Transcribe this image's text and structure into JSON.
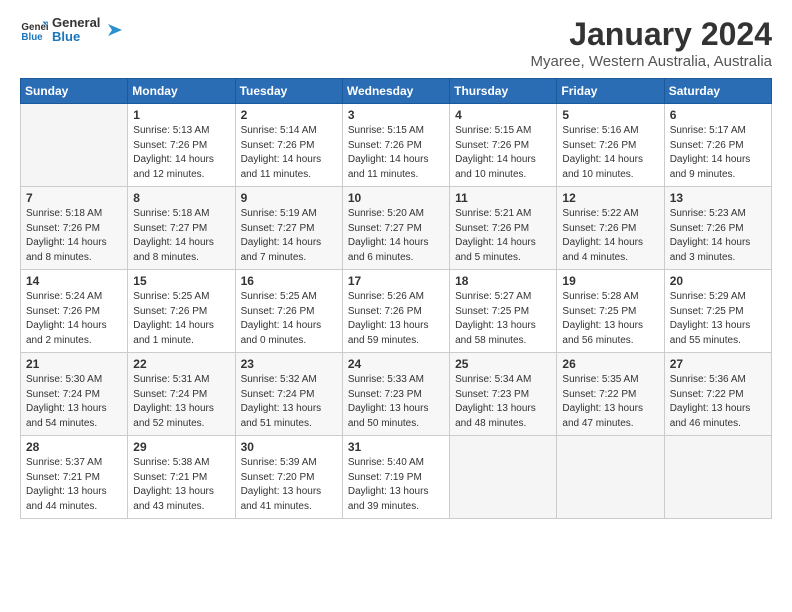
{
  "logo": {
    "text_general": "General",
    "text_blue": "Blue"
  },
  "title": "January 2024",
  "location": "Myaree, Western Australia, Australia",
  "weekdays": [
    "Sunday",
    "Monday",
    "Tuesday",
    "Wednesday",
    "Thursday",
    "Friday",
    "Saturday"
  ],
  "weeks": [
    [
      {
        "day": "",
        "empty": true
      },
      {
        "day": "1",
        "sunrise": "5:13 AM",
        "sunset": "7:26 PM",
        "daylight": "14 hours and 12 minutes."
      },
      {
        "day": "2",
        "sunrise": "5:14 AM",
        "sunset": "7:26 PM",
        "daylight": "14 hours and 11 minutes."
      },
      {
        "day": "3",
        "sunrise": "5:15 AM",
        "sunset": "7:26 PM",
        "daylight": "14 hours and 11 minutes."
      },
      {
        "day": "4",
        "sunrise": "5:15 AM",
        "sunset": "7:26 PM",
        "daylight": "14 hours and 10 minutes."
      },
      {
        "day": "5",
        "sunrise": "5:16 AM",
        "sunset": "7:26 PM",
        "daylight": "14 hours and 10 minutes."
      },
      {
        "day": "6",
        "sunrise": "5:17 AM",
        "sunset": "7:26 PM",
        "daylight": "14 hours and 9 minutes."
      }
    ],
    [
      {
        "day": "7",
        "sunrise": "5:18 AM",
        "sunset": "7:26 PM",
        "daylight": "14 hours and 8 minutes."
      },
      {
        "day": "8",
        "sunrise": "5:18 AM",
        "sunset": "7:27 PM",
        "daylight": "14 hours and 8 minutes."
      },
      {
        "day": "9",
        "sunrise": "5:19 AM",
        "sunset": "7:27 PM",
        "daylight": "14 hours and 7 minutes."
      },
      {
        "day": "10",
        "sunrise": "5:20 AM",
        "sunset": "7:27 PM",
        "daylight": "14 hours and 6 minutes."
      },
      {
        "day": "11",
        "sunrise": "5:21 AM",
        "sunset": "7:26 PM",
        "daylight": "14 hours and 5 minutes."
      },
      {
        "day": "12",
        "sunrise": "5:22 AM",
        "sunset": "7:26 PM",
        "daylight": "14 hours and 4 minutes."
      },
      {
        "day": "13",
        "sunrise": "5:23 AM",
        "sunset": "7:26 PM",
        "daylight": "14 hours and 3 minutes."
      }
    ],
    [
      {
        "day": "14",
        "sunrise": "5:24 AM",
        "sunset": "7:26 PM",
        "daylight": "14 hours and 2 minutes."
      },
      {
        "day": "15",
        "sunrise": "5:25 AM",
        "sunset": "7:26 PM",
        "daylight": "14 hours and 1 minute."
      },
      {
        "day": "16",
        "sunrise": "5:25 AM",
        "sunset": "7:26 PM",
        "daylight": "14 hours and 0 minutes."
      },
      {
        "day": "17",
        "sunrise": "5:26 AM",
        "sunset": "7:26 PM",
        "daylight": "13 hours and 59 minutes."
      },
      {
        "day": "18",
        "sunrise": "5:27 AM",
        "sunset": "7:25 PM",
        "daylight": "13 hours and 58 minutes."
      },
      {
        "day": "19",
        "sunrise": "5:28 AM",
        "sunset": "7:25 PM",
        "daylight": "13 hours and 56 minutes."
      },
      {
        "day": "20",
        "sunrise": "5:29 AM",
        "sunset": "7:25 PM",
        "daylight": "13 hours and 55 minutes."
      }
    ],
    [
      {
        "day": "21",
        "sunrise": "5:30 AM",
        "sunset": "7:24 PM",
        "daylight": "13 hours and 54 minutes."
      },
      {
        "day": "22",
        "sunrise": "5:31 AM",
        "sunset": "7:24 PM",
        "daylight": "13 hours and 52 minutes."
      },
      {
        "day": "23",
        "sunrise": "5:32 AM",
        "sunset": "7:24 PM",
        "daylight": "13 hours and 51 minutes."
      },
      {
        "day": "24",
        "sunrise": "5:33 AM",
        "sunset": "7:23 PM",
        "daylight": "13 hours and 50 minutes."
      },
      {
        "day": "25",
        "sunrise": "5:34 AM",
        "sunset": "7:23 PM",
        "daylight": "13 hours and 48 minutes."
      },
      {
        "day": "26",
        "sunrise": "5:35 AM",
        "sunset": "7:22 PM",
        "daylight": "13 hours and 47 minutes."
      },
      {
        "day": "27",
        "sunrise": "5:36 AM",
        "sunset": "7:22 PM",
        "daylight": "13 hours and 46 minutes."
      }
    ],
    [
      {
        "day": "28",
        "sunrise": "5:37 AM",
        "sunset": "7:21 PM",
        "daylight": "13 hours and 44 minutes."
      },
      {
        "day": "29",
        "sunrise": "5:38 AM",
        "sunset": "7:21 PM",
        "daylight": "13 hours and 43 minutes."
      },
      {
        "day": "30",
        "sunrise": "5:39 AM",
        "sunset": "7:20 PM",
        "daylight": "13 hours and 41 minutes."
      },
      {
        "day": "31",
        "sunrise": "5:40 AM",
        "sunset": "7:19 PM",
        "daylight": "13 hours and 39 minutes."
      },
      {
        "day": "",
        "empty": true
      },
      {
        "day": "",
        "empty": true
      },
      {
        "day": "",
        "empty": true
      }
    ]
  ]
}
